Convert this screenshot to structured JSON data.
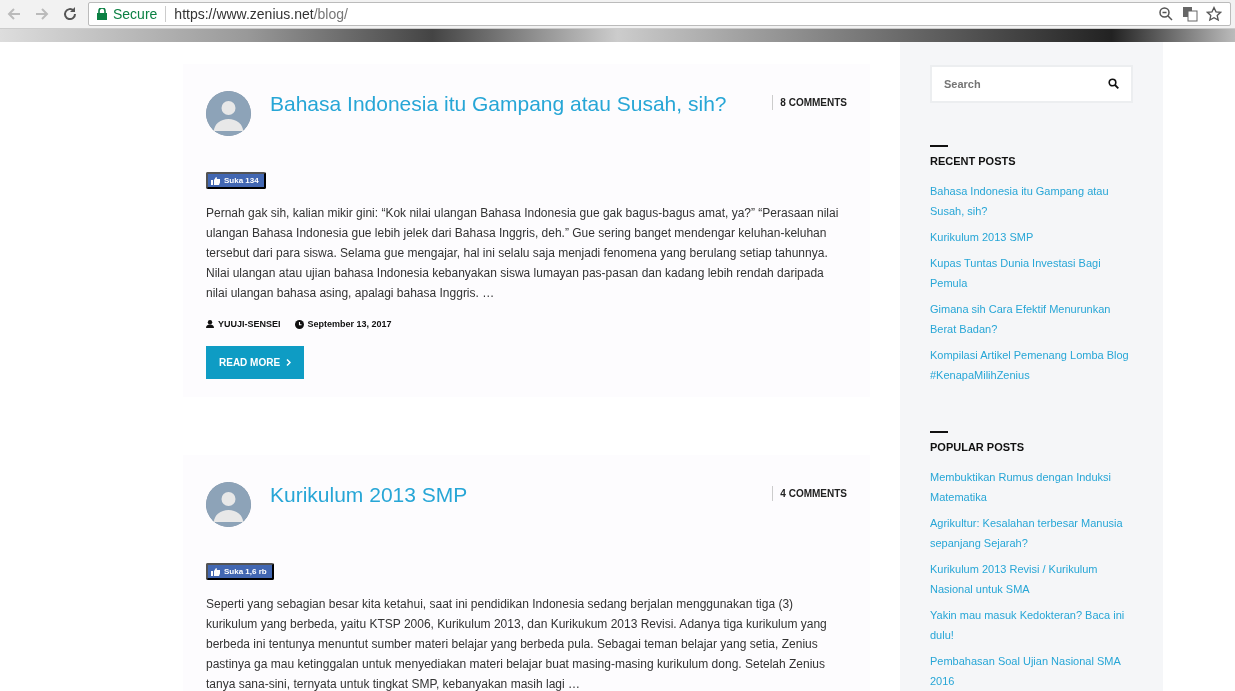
{
  "browser": {
    "secure_label": "Secure",
    "url_host": "https://www.zenius.net",
    "url_path": "/blog/"
  },
  "posts": [
    {
      "title": "Bahasa Indonesia itu Gampang atau Susah, sih?",
      "comments": "8 COMMENTS",
      "like": "Suka 134",
      "excerpt": "Pernah gak sih, kalian mikir gini: “Kok nilai ulangan Bahasa Indonesia gue gak bagus-bagus amat, ya?” “Perasaan nilai ulangan Bahasa Indonesia gue lebih jelek dari Bahasa Inggris, deh.” Gue sering banget mendengar keluhan-keluhan tersebut dari para siswa. Selama gue mengajar, hal ini selalu saja menjadi fenomena yang berulang setiap tahunnya. Nilai ulangan atau ujian bahasa Indonesia kebanyakan siswa lumayan pas-pasan dan kadang lebih rendah daripada nilai ulangan bahasa asing, apalagi bahasa Inggris. …",
      "author": "YUUJI-SENSEI",
      "date": "September 13, 2017",
      "read_more": "READ MORE"
    },
    {
      "title": "Kurikulum 2013 SMP",
      "comments": "4 COMMENTS",
      "like": "Suka 1,6 rb",
      "excerpt": "Seperti yang sebagian besar kita ketahui, saat ini pendidikan Indonesia sedang berjalan menggunakan tiga (3) kurikulum yang berbeda, yaitu KTSP 2006, Kurikulum 2013, dan Kurikukum 2013 Revisi. Adanya tiga kurikulum yang berbeda ini tentunya menuntut sumber materi belajar yang berbeda pula. Sebagai teman belajar yang setia, Zenius pastinya ga mau ketinggalan untuk menyediakan materi belajar buat masing-masing kurikulum dong. Setelah Zenius tanya sana-sini, ternyata untuk tingkat SMP, kebanyakan masih lagi …"
    }
  ],
  "sidebar": {
    "search": {
      "placeholder": "Search"
    },
    "widgets": [
      {
        "heading": "RECENT POSTS",
        "items": [
          "Bahasa Indonesia itu Gampang atau Susah, sih?",
          "Kurikulum 2013 SMP",
          "Kupas Tuntas Dunia Investasi Bagi Pemula",
          "Gimana sih Cara Efektif Menurunkan Berat Badan?",
          "Kompilasi Artikel Pemenang Lomba Blog #KenapaMilihZenius"
        ]
      },
      {
        "heading": "POPULAR POSTS",
        "items": [
          "Membuktikan Rumus dengan Induksi Matematika",
          "Agrikultur: Kesalahan terbesar Manusia sepanjang Sejarah?",
          "Kurikulum 2013 Revisi / Kurikulum Nasional untuk SMA",
          "Yakin mau masuk Kedokteran? Baca ini dulu!",
          "Pembahasan Soal Ujian Nasional SMA 2016"
        ]
      }
    ]
  }
}
